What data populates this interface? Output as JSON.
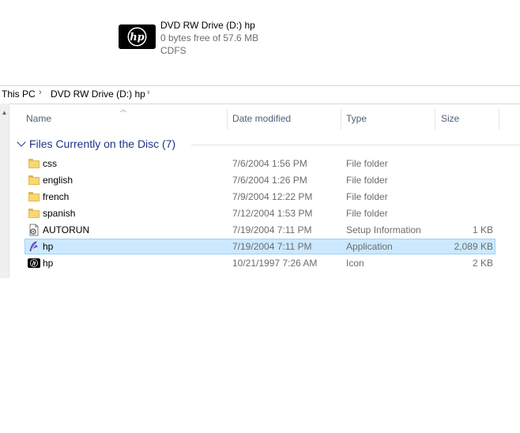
{
  "drive": {
    "name": "DVD RW Drive (D:) hp",
    "space": "0 bytes free of 57.6 MB",
    "filesystem": "CDFS",
    "logo_text": "hp"
  },
  "address": {
    "crumbs": [
      "This PC",
      "DVD RW Drive (D:) hp"
    ],
    "separator": "›"
  },
  "columns": {
    "name": "Name",
    "date": "Date modified",
    "type": "Type",
    "size": "Size"
  },
  "group": {
    "title": "Files Currently on the Disc (7)"
  },
  "files": [
    {
      "name": "css",
      "date": "7/6/2004 1:56 PM",
      "type": "File folder",
      "size": "",
      "icon": "folder-icon"
    },
    {
      "name": "english",
      "date": "7/6/2004 1:26 PM",
      "type": "File folder",
      "size": "",
      "icon": "folder-icon"
    },
    {
      "name": "french",
      "date": "7/9/2004 12:22 PM",
      "type": "File folder",
      "size": "",
      "icon": "folder-icon"
    },
    {
      "name": "spanish",
      "date": "7/12/2004 1:53 PM",
      "type": "File folder",
      "size": "",
      "icon": "folder-icon"
    },
    {
      "name": "AUTORUN",
      "date": "7/19/2004 7:11 PM",
      "type": "Setup Information",
      "size": "1 KB",
      "icon": "setup-info-icon"
    },
    {
      "name": "hp",
      "date": "7/19/2004 7:11 PM",
      "type": "Application",
      "size": "2,089 KB",
      "icon": "application-icon",
      "selected": true
    },
    {
      "name": "hp",
      "date": "10/21/1997 7:26 AM",
      "type": "Icon",
      "size": "2 KB",
      "icon": "hp-icon-file-icon"
    }
  ],
  "colors": {
    "selection": "#cce8ff",
    "selection_border": "#99d1ff",
    "group_text": "#1e3287",
    "header_text": "#4c607a",
    "folder": "#f8d775"
  }
}
